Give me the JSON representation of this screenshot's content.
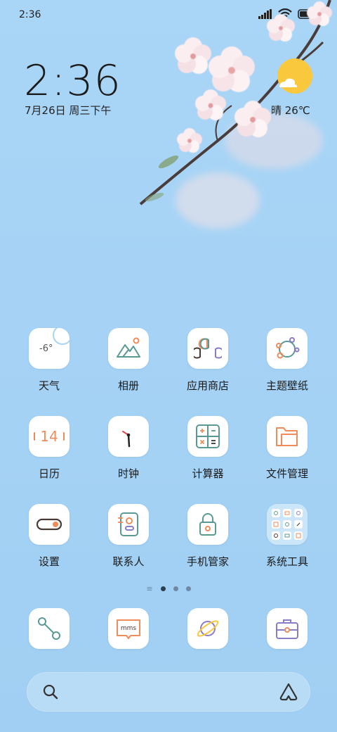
{
  "status_bar": {
    "time": "2:36"
  },
  "lockscreen": {
    "clock": "2:36",
    "date": "7月26日 周三下午",
    "weather": "晴 26℃"
  },
  "apps": [
    {
      "label": "天气",
      "icon": "weather-icon",
      "value": "-6°"
    },
    {
      "label": "相册",
      "icon": "gallery-icon"
    },
    {
      "label": "应用商店",
      "icon": "app-store-icon"
    },
    {
      "label": "主题壁纸",
      "icon": "themes-icon"
    },
    {
      "label": "日历",
      "icon": "calendar-icon",
      "value": "14"
    },
    {
      "label": "时钟",
      "icon": "clock-icon"
    },
    {
      "label": "计算器",
      "icon": "calculator-icon"
    },
    {
      "label": "文件管理",
      "icon": "folder-icon"
    },
    {
      "label": "设置",
      "icon": "settings-toggle-icon"
    },
    {
      "label": "联系人",
      "icon": "contacts-icon"
    },
    {
      "label": "手机管家",
      "icon": "security-lock-icon"
    },
    {
      "label": "系统工具",
      "icon": "system-tools-folder-icon"
    }
  ],
  "dock": [
    {
      "name": "phone",
      "icon": "phone-icon"
    },
    {
      "name": "messages",
      "icon": "mms-icon",
      "text": "mms"
    },
    {
      "name": "browser",
      "icon": "browser-planet-icon"
    },
    {
      "name": "toolbox",
      "icon": "toolbox-icon"
    }
  ],
  "page_indicator": {
    "pages": 3,
    "active": 1
  },
  "colors": {
    "background": "#a6d3f5",
    "weather_sun": "#f9c83c",
    "accent_teal": "#5a9a94",
    "accent_orange": "#f08c5a"
  }
}
